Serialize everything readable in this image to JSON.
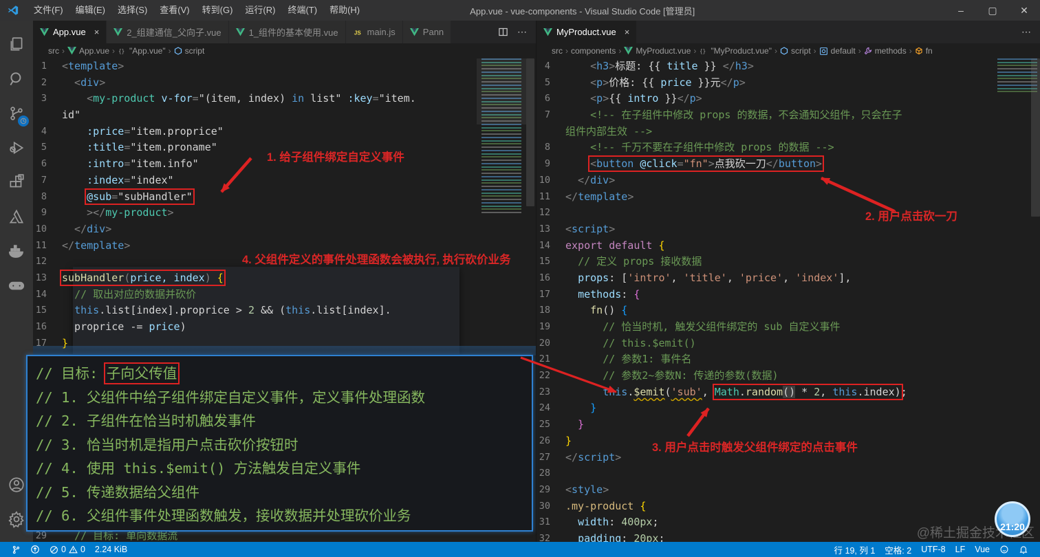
{
  "colors": {
    "statusbar": "#007acc",
    "annotation_red": "#dd2222",
    "vue_green": "#41b883",
    "badge_blue": "#3f9ae0"
  },
  "title_bar": {
    "title": "App.vue - vue-components - Visual Studio Code [管理员]",
    "menus": [
      "文件(F)",
      "编辑(E)",
      "选择(S)",
      "查看(V)",
      "转到(G)",
      "运行(R)",
      "终端(T)",
      "帮助(H)"
    ],
    "window_controls": [
      "minimize",
      "maximize",
      "close"
    ]
  },
  "activity_bar": {
    "top_items": [
      "explorer",
      "search",
      "source-control",
      "run-debug",
      "extensions",
      "azure",
      "docker",
      "game-runner"
    ],
    "bottom_items": [
      "account",
      "settings"
    ],
    "source_control_badge": "clock"
  },
  "left_group": {
    "tabs": [
      {
        "label": "App.vue",
        "icon": "vue",
        "active": true,
        "close": "×"
      },
      {
        "label": "2_组建通信_父向子.vue",
        "icon": "vue",
        "active": false
      },
      {
        "label": "1_组件的基本使用.vue",
        "icon": "vue",
        "active": false
      },
      {
        "label": "main.js",
        "icon": "js",
        "active": false
      },
      {
        "label": "Pann",
        "icon": "vue",
        "active": false
      }
    ],
    "actions": [
      "split-editor",
      "more"
    ],
    "breadcrumb": [
      {
        "t": "src",
        "icon": ""
      },
      {
        "t": "App.vue",
        "icon": "vue"
      },
      {
        "t": "\"App.vue\"",
        "icon": "braces"
      },
      {
        "t": "script",
        "icon": "sym"
      }
    ],
    "rows": [
      {
        "n": "1",
        "s": [
          [
            "<",
            "p"
          ],
          [
            "template",
            "tag"
          ],
          [
            ">",
            "p"
          ]
        ]
      },
      {
        "n": "2",
        "s": [
          [
            "  <",
            "p"
          ],
          [
            "div",
            "tag"
          ],
          [
            ">",
            "p"
          ]
        ]
      },
      {
        "n": "3",
        "s": [
          [
            "    <",
            "p"
          ],
          [
            "my-product",
            "comp"
          ],
          [
            " ",
            "d"
          ],
          [
            "v-for",
            "attr"
          ],
          [
            "=",
            "p"
          ],
          [
            "\"(item, index) ",
            "d"
          ],
          [
            "in",
            "kb"
          ],
          [
            " list\"",
            "d"
          ],
          [
            " ",
            "d"
          ],
          [
            ":key",
            "attr"
          ],
          [
            "=",
            "p"
          ],
          [
            "\"item.",
            "d"
          ]
        ]
      },
      {
        "n": "",
        "s": [
          [
            "id\"",
            "d"
          ]
        ]
      },
      {
        "n": "4",
        "s": [
          [
            "    ",
            "d"
          ],
          [
            ":price",
            "attr"
          ],
          [
            "=",
            "p"
          ],
          [
            "\"item.proprice\"",
            "d"
          ]
        ]
      },
      {
        "n": "5",
        "s": [
          [
            "    ",
            "d"
          ],
          [
            ":title",
            "attr"
          ],
          [
            "=",
            "p"
          ],
          [
            "\"item.proname\"",
            "d"
          ]
        ]
      },
      {
        "n": "6",
        "s": [
          [
            "    ",
            "d"
          ],
          [
            ":intro",
            "attr"
          ],
          [
            "=",
            "p"
          ],
          [
            "\"item.info\"",
            "d"
          ]
        ]
      },
      {
        "n": "7",
        "s": [
          [
            "    ",
            "d"
          ],
          [
            ":index",
            "attr"
          ],
          [
            "=",
            "p"
          ],
          [
            "\"index\"",
            "d"
          ]
        ]
      },
      {
        "n": "8",
        "s": [
          [
            "    ",
            "d"
          ],
          [
            "@sub",
            "attr",
            "b"
          ],
          [
            "=",
            "p",
            "b"
          ],
          [
            "\"subHandler\"",
            "d",
            "b"
          ]
        ]
      },
      {
        "n": "9",
        "s": [
          [
            "    >",
            "p"
          ],
          [
            "</",
            "p"
          ],
          [
            "my-product",
            "comp"
          ],
          [
            ">",
            "p"
          ]
        ]
      },
      {
        "n": "10",
        "s": [
          [
            "  </",
            "p"
          ],
          [
            "div",
            "tag"
          ],
          [
            ">",
            "p"
          ]
        ]
      },
      {
        "n": "11",
        "s": [
          [
            "</",
            "p"
          ],
          [
            "template",
            "tag"
          ],
          [
            ">",
            "p"
          ]
        ]
      },
      {
        "n": "12",
        "s": []
      },
      {
        "n": "13",
        "s": [
          [
            "subHandler",
            "fn",
            "b"
          ],
          [
            "(",
            "p",
            "b"
          ],
          [
            "price, index",
            "attr",
            "b"
          ],
          [
            ") ",
            "p",
            "b"
          ],
          [
            "{",
            "b1",
            "b"
          ]
        ]
      },
      {
        "n": "14",
        "s": [
          [
            "  ",
            "d"
          ],
          [
            "// 取出对应的数据并砍价",
            "com"
          ]
        ]
      },
      {
        "n": "15",
        "s": [
          [
            "  ",
            "d"
          ],
          [
            "this",
            "kb"
          ],
          [
            ".list[index].proprice > ",
            "d"
          ],
          [
            "2",
            "num"
          ],
          [
            " && (",
            "d"
          ],
          [
            "this",
            "kb"
          ],
          [
            ".list[index].",
            "d"
          ]
        ]
      },
      {
        "n": "16",
        "s": [
          [
            "  proprice -= ",
            "d"
          ],
          [
            "price",
            "attr"
          ],
          [
            ")",
            "d"
          ]
        ]
      },
      {
        "n": "17",
        "s": [
          [
            "}",
            "b1"
          ]
        ]
      }
    ],
    "bottom_row": {
      "n": "29",
      "s": [
        [
          "  ",
          "d"
        ],
        [
          "// 目标: 单向数据流",
          "com"
        ]
      ]
    }
  },
  "right_group": {
    "tabs": [
      {
        "label": "MyProduct.vue",
        "icon": "vue",
        "active": true,
        "close": "×"
      }
    ],
    "actions": [
      "more"
    ],
    "breadcrumb": [
      {
        "t": "src",
        "icon": ""
      },
      {
        "t": "components",
        "icon": ""
      },
      {
        "t": "MyProduct.vue",
        "icon": "vue"
      },
      {
        "t": "\"MyProduct.vue\"",
        "icon": "braces"
      },
      {
        "t": "script",
        "icon": "sym"
      },
      {
        "t": "default",
        "icon": "at"
      },
      {
        "t": "methods",
        "icon": "wrench"
      },
      {
        "t": "fn",
        "icon": "cube"
      }
    ],
    "rows": [
      {
        "n": "4",
        "s": [
          [
            "    <",
            "p"
          ],
          [
            "h3",
            "tag"
          ],
          [
            ">",
            "p"
          ],
          [
            "标题: ",
            "d"
          ],
          [
            "{{ ",
            "d"
          ],
          [
            "title",
            "attr"
          ],
          [
            " }} ",
            "d"
          ],
          [
            "</",
            "p"
          ],
          [
            "h3",
            "tag"
          ],
          [
            ">",
            "p"
          ]
        ]
      },
      {
        "n": "5",
        "s": [
          [
            "    <",
            "p"
          ],
          [
            "p",
            "tag"
          ],
          [
            ">",
            "p"
          ],
          [
            "价格: ",
            "d"
          ],
          [
            "{{ ",
            "d"
          ],
          [
            "price",
            "attr"
          ],
          [
            " }}",
            "d"
          ],
          [
            "元",
            "d"
          ],
          [
            "</",
            "p"
          ],
          [
            "p",
            "tag"
          ],
          [
            ">",
            "p"
          ]
        ]
      },
      {
        "n": "6",
        "s": [
          [
            "    <",
            "p"
          ],
          [
            "p",
            "tag"
          ],
          [
            ">",
            "p"
          ],
          [
            "{{ ",
            "d"
          ],
          [
            "intro",
            "attr"
          ],
          [
            " }}",
            "d"
          ],
          [
            "</",
            "p"
          ],
          [
            "p",
            "tag"
          ],
          [
            ">",
            "p"
          ]
        ]
      },
      {
        "n": "7",
        "s": [
          [
            "    ",
            "d"
          ],
          [
            "<!-- 在子组件中修改 props 的数据，不会通知父组件，只会在子",
            "com"
          ]
        ]
      },
      {
        "n": "",
        "s": [
          [
            "组件内部生效 -->",
            "com"
          ]
        ]
      },
      {
        "n": "8",
        "s": [
          [
            "    ",
            "d"
          ],
          [
            "<!-- 千万不要在子组件中修改 props 的数据 -->",
            "com"
          ]
        ]
      },
      {
        "n": "9",
        "s": [
          [
            "    ",
            "d"
          ],
          [
            "<",
            "p",
            "b"
          ],
          [
            "button",
            "tag",
            "b"
          ],
          [
            " ",
            "d",
            "b"
          ],
          [
            "@click",
            "attr",
            "b"
          ],
          [
            "=",
            "p",
            "b"
          ],
          [
            "\"fn\"",
            "str",
            "b"
          ],
          [
            ">",
            "p",
            "b"
          ],
          [
            "点我砍一刀",
            "d",
            "b"
          ],
          [
            "</",
            "p",
            "b"
          ],
          [
            "button",
            "tag",
            "b"
          ],
          [
            ">",
            "p",
            "b"
          ]
        ]
      },
      {
        "n": "10",
        "s": [
          [
            "  </",
            "p"
          ],
          [
            "div",
            "tag"
          ],
          [
            ">",
            "p"
          ]
        ]
      },
      {
        "n": "11",
        "s": [
          [
            "</",
            "p"
          ],
          [
            "template",
            "tag"
          ],
          [
            ">",
            "p"
          ]
        ]
      },
      {
        "n": "12",
        "s": []
      },
      {
        "n": "13",
        "s": [
          [
            "<",
            "p"
          ],
          [
            "script",
            "tag"
          ],
          [
            ">",
            "p"
          ]
        ]
      },
      {
        "n": "14",
        "s": [
          [
            "export",
            "kw"
          ],
          [
            " ",
            "d"
          ],
          [
            "default",
            "kw"
          ],
          [
            " ",
            "d"
          ],
          [
            "{",
            "b1"
          ]
        ]
      },
      {
        "n": "15",
        "s": [
          [
            "  ",
            "d"
          ],
          [
            "// 定义 props 接收数据",
            "com"
          ]
        ]
      },
      {
        "n": "16",
        "s": [
          [
            "  ",
            "d"
          ],
          [
            "props",
            "attr"
          ],
          [
            ": [",
            "d"
          ],
          [
            "'intro'",
            "str"
          ],
          [
            ", ",
            "d"
          ],
          [
            "'title'",
            "str"
          ],
          [
            ", ",
            "d"
          ],
          [
            "'price'",
            "str"
          ],
          [
            ", ",
            "d"
          ],
          [
            "'index'",
            "str"
          ],
          [
            "],",
            "d"
          ]
        ]
      },
      {
        "n": "17",
        "s": [
          [
            "  ",
            "d"
          ],
          [
            "methods",
            "attr"
          ],
          [
            ": ",
            "d"
          ],
          [
            "{",
            "b2"
          ]
        ]
      },
      {
        "n": "18",
        "s": [
          [
            "    ",
            "d"
          ],
          [
            "fn",
            "fn"
          ],
          [
            "() ",
            "d"
          ],
          [
            "{",
            "b3"
          ]
        ]
      },
      {
        "n": "19",
        "s": [
          [
            "      ",
            "d"
          ],
          [
            "// 恰当时机, 触发父组件绑定的 sub 自定义事件",
            "com"
          ]
        ]
      },
      {
        "n": "20",
        "s": [
          [
            "      ",
            "d"
          ],
          [
            "// this.$emit()",
            "com"
          ]
        ]
      },
      {
        "n": "21",
        "s": [
          [
            "      ",
            "d"
          ],
          [
            "// 参数1: 事件名",
            "com"
          ]
        ]
      },
      {
        "n": "22",
        "s": [
          [
            "      ",
            "d"
          ],
          [
            "// 参数2~参数N: 传递的参数(数据)",
            "com"
          ]
        ]
      },
      {
        "n": "23",
        "s": [
          [
            "      ",
            "d"
          ],
          [
            "this",
            "kb"
          ],
          [
            ".",
            "d"
          ],
          [
            "$emit",
            "fn sq"
          ],
          [
            "(",
            "d"
          ],
          [
            "'sub'",
            "str sq"
          ],
          [
            ", ",
            "d"
          ],
          [
            "Math",
            "comp",
            "b"
          ],
          [
            ".",
            "d",
            "b"
          ],
          [
            "random",
            "fn",
            "b"
          ],
          [
            "()",
            "d match",
            "b"
          ],
          [
            " * ",
            "d",
            "b"
          ],
          [
            "2",
            "num",
            "b"
          ],
          [
            ", ",
            "d",
            "b"
          ],
          [
            "this",
            "kb",
            "b"
          ],
          [
            ".index",
            "d",
            "b"
          ],
          [
            ")",
            "d",
            "b"
          ],
          [
            ";",
            "d"
          ]
        ]
      },
      {
        "n": "24",
        "s": [
          [
            "    }",
            "b3"
          ]
        ]
      },
      {
        "n": "25",
        "s": [
          [
            "  }",
            "b2"
          ]
        ]
      },
      {
        "n": "26",
        "s": [
          [
            "}",
            "b1"
          ]
        ]
      },
      {
        "n": "27",
        "s": [
          [
            "</",
            "p"
          ],
          [
            "script",
            "tag"
          ],
          [
            ">",
            "p"
          ]
        ]
      },
      {
        "n": "28",
        "s": []
      },
      {
        "n": "29",
        "s": [
          [
            "<",
            "p"
          ],
          [
            "style",
            "tag"
          ],
          [
            ">",
            "p"
          ]
        ]
      },
      {
        "n": "30",
        "s": [
          [
            ".my-product",
            "sel"
          ],
          [
            " ",
            "d"
          ],
          [
            "{",
            "b1"
          ]
        ]
      },
      {
        "n": "31",
        "s": [
          [
            "  ",
            "d"
          ],
          [
            "width",
            "attr"
          ],
          [
            ": ",
            "d"
          ],
          [
            "400px",
            "num"
          ],
          [
            ";",
            "d"
          ]
        ]
      },
      {
        "n": "32",
        "s": [
          [
            "  ",
            "d"
          ],
          [
            "padding",
            "attr"
          ],
          [
            ": ",
            "d"
          ],
          [
            "20px",
            "num"
          ],
          [
            ";",
            "d"
          ]
        ]
      }
    ]
  },
  "overlay_notes": {
    "lines": [
      [
        [
          "// 目标: ",
          ""
        ],
        [
          "子向父传值",
          "",
          "b"
        ]
      ],
      [
        [
          "// 1. 父组件中给子组件绑定自定义事件，定义事件处理函数",
          ""
        ]
      ],
      [
        [
          "// 2. 子组件在恰当时机触发事件",
          ""
        ]
      ],
      [
        [
          "// 3. 恰当时机是指用户点击砍价按钮时",
          ""
        ]
      ],
      [
        [
          "// 4. 使用 this.$emit() 方法触发自定义事件",
          ""
        ]
      ],
      [
        [
          "// 5. 传递数据给父组件",
          ""
        ]
      ],
      [
        [
          "// 6. 父组件事件处理函数触发，接收数据并处理砍价业务",
          ""
        ]
      ]
    ]
  },
  "annotations": {
    "note1": {
      "text": "1. 给子组件绑定自定义事件"
    },
    "note2": {
      "text": "2. 用户点击砍一刀"
    },
    "note3": {
      "text": "3. 用户点击时触发父组件绑定的点击事件"
    },
    "note4": {
      "text": "4. 父组件定义的事件处理函数会被执行, 执行砍价业务"
    }
  },
  "status_bar": {
    "errors": "0",
    "warnings": "0",
    "file_size": "2.24 KiB",
    "cursor": "行 19, 列 1",
    "indent": "空格: 2",
    "encoding": "UTF-8",
    "eol": "LF",
    "language": "Vue"
  },
  "watermark": {
    "badge_time": "21:20",
    "text": "@稀土掘金技术社区"
  }
}
